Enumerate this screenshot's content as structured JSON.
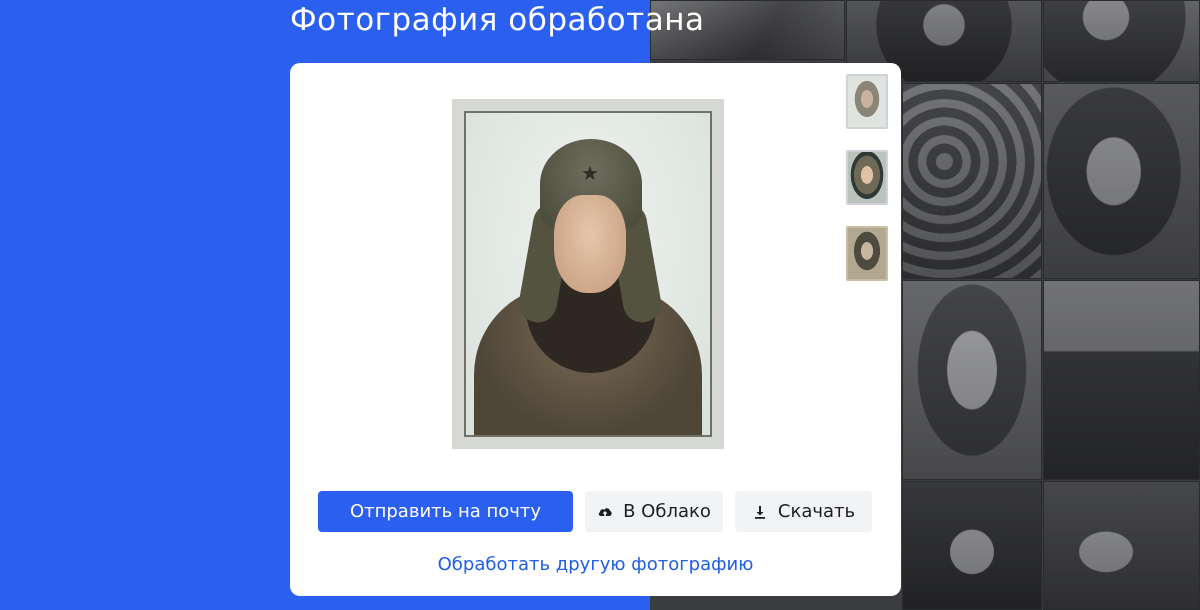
{
  "page": {
    "title": "Фотография обработана"
  },
  "actions": {
    "send_email_label": "Отправить на почту",
    "cloud_label": "В Облако",
    "download_label": "Скачать",
    "process_another_label": "Обработать другую фотографию"
  },
  "icons": {
    "cloud": "cloud-upload-icon",
    "download": "download-icon"
  },
  "thumbnails": [
    {
      "name": "thumbnail-variant-1"
    },
    {
      "name": "thumbnail-variant-2"
    },
    {
      "name": "thumbnail-variant-3"
    }
  ],
  "colors": {
    "accent": "#2a5ff0",
    "link": "#1e5ee6",
    "secondary_button_bg": "#f2f3f5"
  }
}
